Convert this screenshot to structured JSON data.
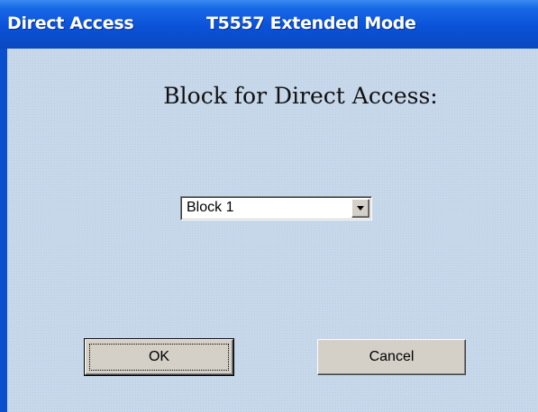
{
  "window": {
    "title_left": "Direct Access",
    "title_right": "T5557 Extended Mode"
  },
  "dialog": {
    "heading": "Block for Direct Access:",
    "block_select": {
      "selected": "Block 1"
    },
    "ok_label": "OK",
    "cancel_label": "Cancel"
  },
  "colors": {
    "titlebar": "#0b52d8",
    "client_bg": "#c8d8eb",
    "button_face": "#d4d0c8"
  },
  "icons": {
    "dropdown": "chevron-down-icon"
  }
}
